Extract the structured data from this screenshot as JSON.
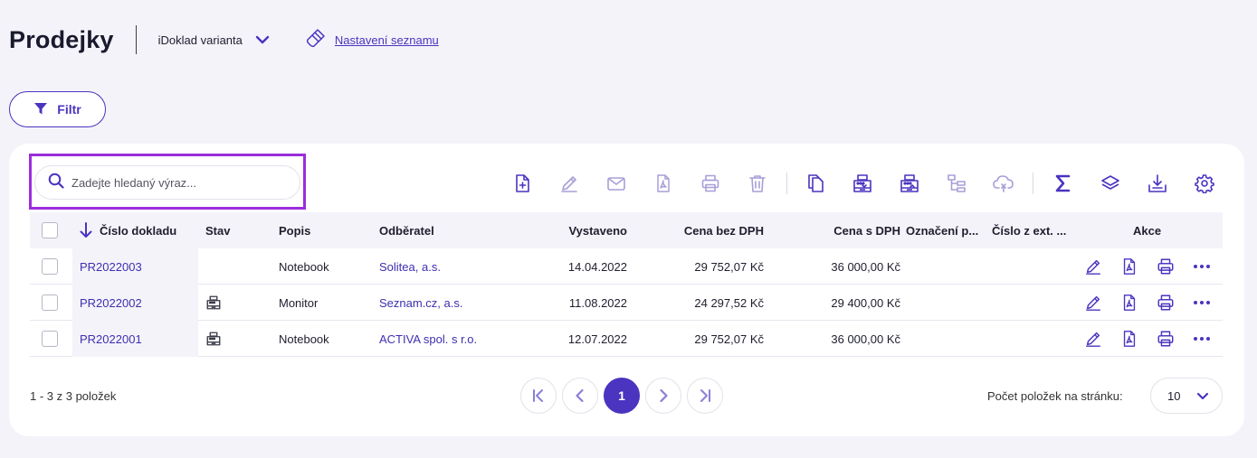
{
  "header": {
    "title": "Prodejky",
    "variant_label": "iDoklad varianta",
    "settings_link": "Nastavení seznamu"
  },
  "filter": {
    "label": "Filtr"
  },
  "search": {
    "placeholder": "Zadejte hledaný výraz..."
  },
  "toolbar": {
    "icons": [
      "new-document-icon",
      "edit-icon",
      "email-icon",
      "pdf-icon",
      "print-icon",
      "delete-icon",
      "copy-icon",
      "cash-register-icon",
      "cash-register-alt-icon",
      "hierarchy-icon",
      "cloud-export-icon",
      "sum-icon",
      "layers-icon",
      "download-icon",
      "settings-gear-icon"
    ]
  },
  "table": {
    "columns": {
      "number": "Číslo dokladu",
      "status": "Stav",
      "description": "Popis",
      "customer": "Odběratel",
      "issued": "Vystaveno",
      "price_ex_vat": "Cena bez DPH",
      "price_vat": "Cena s DPH",
      "label": "Označení p...",
      "ext_number": "Číslo z ext. ...",
      "actions": "Akce"
    },
    "rows": [
      {
        "number": "PR2022003",
        "status_icon": "",
        "description": "Notebook",
        "customer": "Solitea, a.s.",
        "issued": "14.04.2022",
        "price_ex_vat": "29 752,07 Kč",
        "price_vat": "36 000,00 Kč",
        "label": "",
        "ext_number": ""
      },
      {
        "number": "PR2022002",
        "status_icon": "cash-register-icon",
        "description": "Monitor",
        "customer": "Seznam.cz, a.s.",
        "issued": "11.08.2022",
        "price_ex_vat": "24 297,52 Kč",
        "price_vat": "29 400,00 Kč",
        "label": "",
        "ext_number": ""
      },
      {
        "number": "PR2022001",
        "status_icon": "cash-register-icon",
        "description": "Notebook",
        "customer": "ACTIVA spol. s r.o.",
        "issued": "12.07.2022",
        "price_ex_vat": "29 752,07 Kč",
        "price_vat": "36 000,00 Kč",
        "label": "",
        "ext_number": ""
      }
    ]
  },
  "footer": {
    "count_text": "1 - 3 z 3 položek",
    "current_page": "1",
    "per_page_label": "Počet položek na stránku:",
    "per_page_value": "10"
  },
  "colors": {
    "accent": "#4a34c0",
    "highlight": "#9b2ddb",
    "background": "#f4f3f9"
  }
}
